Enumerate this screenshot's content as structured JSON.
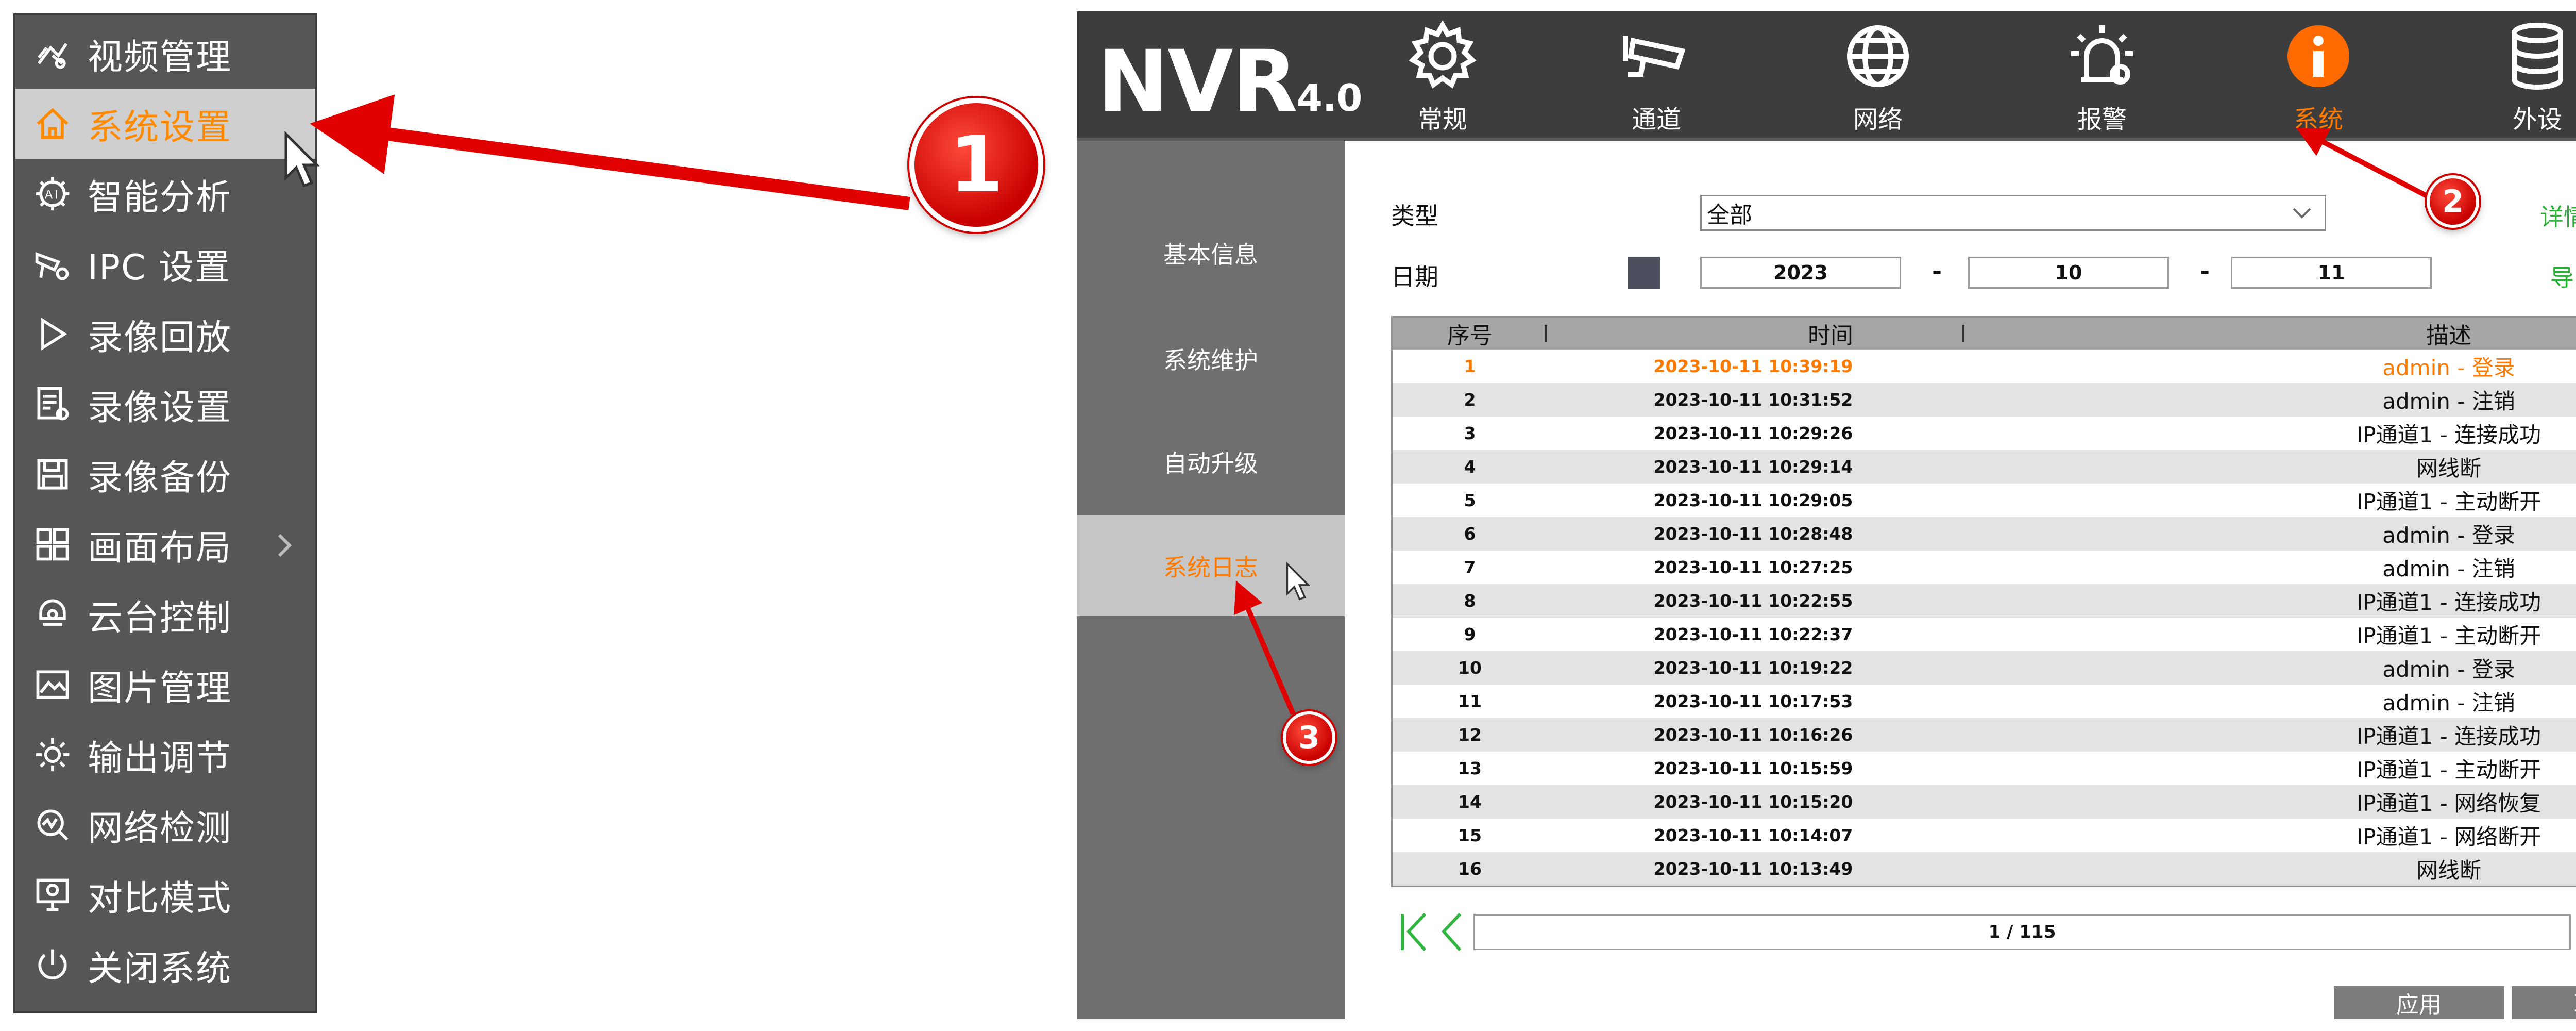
{
  "context_menu": {
    "items": [
      {
        "label": "视频管理",
        "icon": "video-management-icon"
      },
      {
        "label": "系统设置",
        "icon": "home-icon",
        "active": true
      },
      {
        "label": "智能分析",
        "icon": "ai-gear-icon"
      },
      {
        "label": "IPC 设置",
        "icon": "camera-gear-icon"
      },
      {
        "label": "录像回放",
        "icon": "play-icon"
      },
      {
        "label": "录像设置",
        "icon": "record-settings-icon"
      },
      {
        "label": "录像备份",
        "icon": "save-disk-icon"
      },
      {
        "label": "画面布局",
        "icon": "grid-layout-icon",
        "submenu": true
      },
      {
        "label": "云台控制",
        "icon": "ptz-camera-icon"
      },
      {
        "label": "图片管理",
        "icon": "picture-icon"
      },
      {
        "label": "输出调节",
        "icon": "brightness-icon"
      },
      {
        "label": "网络检测",
        "icon": "network-check-icon"
      },
      {
        "label": "对比模式",
        "icon": "monitor-compare-icon"
      },
      {
        "label": "关闭系统",
        "icon": "power-icon"
      }
    ]
  },
  "annotations": {
    "badge1": "1",
    "badge2": "2",
    "badge3": "3"
  },
  "nvr": {
    "logo": "NVR",
    "logo_version": "4.0",
    "tabs": [
      {
        "label": "常规",
        "icon": "gear-icon"
      },
      {
        "label": "通道",
        "icon": "cctv-camera-icon"
      },
      {
        "label": "网络",
        "icon": "globe-icon"
      },
      {
        "label": "报警",
        "icon": "alarm-light-icon"
      },
      {
        "label": "系统",
        "icon": "info-icon",
        "active": true
      },
      {
        "label": "外设",
        "icon": "database-icon"
      }
    ],
    "sidebar": [
      {
        "label": "基本信息"
      },
      {
        "label": "系统维护"
      },
      {
        "label": "自动升级"
      },
      {
        "label": "系统日志",
        "active": true
      }
    ],
    "filters": {
      "type_label": "类型",
      "type_value": "全部",
      "date_label": "日期",
      "year": "2023",
      "month": "10",
      "day": "11",
      "sep1": "-",
      "sep2": "-",
      "details_link": "详情",
      "export_link": "导出"
    },
    "table": {
      "headers": {
        "id": "序号",
        "time": "时间",
        "desc": "描述"
      },
      "rows": [
        {
          "id": "1",
          "time": "2023-10-11 10:39:19",
          "desc": "admin - 登录"
        },
        {
          "id": "2",
          "time": "2023-10-11 10:31:52",
          "desc": "admin - 注销"
        },
        {
          "id": "3",
          "time": "2023-10-11 10:29:26",
          "desc": "IP通道1 - 连接成功"
        },
        {
          "id": "4",
          "time": "2023-10-11 10:29:14",
          "desc": "网线断"
        },
        {
          "id": "5",
          "time": "2023-10-11 10:29:05",
          "desc": "IP通道1 - 主动断开"
        },
        {
          "id": "6",
          "time": "2023-10-11 10:28:48",
          "desc": "admin - 登录"
        },
        {
          "id": "7",
          "time": "2023-10-11 10:27:25",
          "desc": "admin - 注销"
        },
        {
          "id": "8",
          "time": "2023-10-11 10:22:55",
          "desc": "IP通道1 - 连接成功"
        },
        {
          "id": "9",
          "time": "2023-10-11 10:22:37",
          "desc": "IP通道1 - 主动断开"
        },
        {
          "id": "10",
          "time": "2023-10-11 10:19:22",
          "desc": "admin - 登录"
        },
        {
          "id": "11",
          "time": "2023-10-11 10:17:53",
          "desc": "admin - 注销"
        },
        {
          "id": "12",
          "time": "2023-10-11 10:16:26",
          "desc": "IP通道1 - 连接成功"
        },
        {
          "id": "13",
          "time": "2023-10-11 10:15:59",
          "desc": "IP通道1 - 主动断开"
        },
        {
          "id": "14",
          "time": "2023-10-11 10:15:20",
          "desc": "IP通道1 - 网络恢复"
        },
        {
          "id": "15",
          "time": "2023-10-11 10:14:07",
          "desc": "IP通道1 - 网络断开"
        },
        {
          "id": "16",
          "time": "2023-10-11 10:13:49",
          "desc": "网线断"
        }
      ]
    },
    "pager": {
      "indicator": "1 / 115"
    },
    "buttons": {
      "apply": "应用",
      "cancel": "取消"
    }
  },
  "colors": {
    "accent_orange": "#ff7a00",
    "link_green": "#27b334",
    "annotation_red": "#e00000",
    "header_bg": "#3d3d3d"
  }
}
